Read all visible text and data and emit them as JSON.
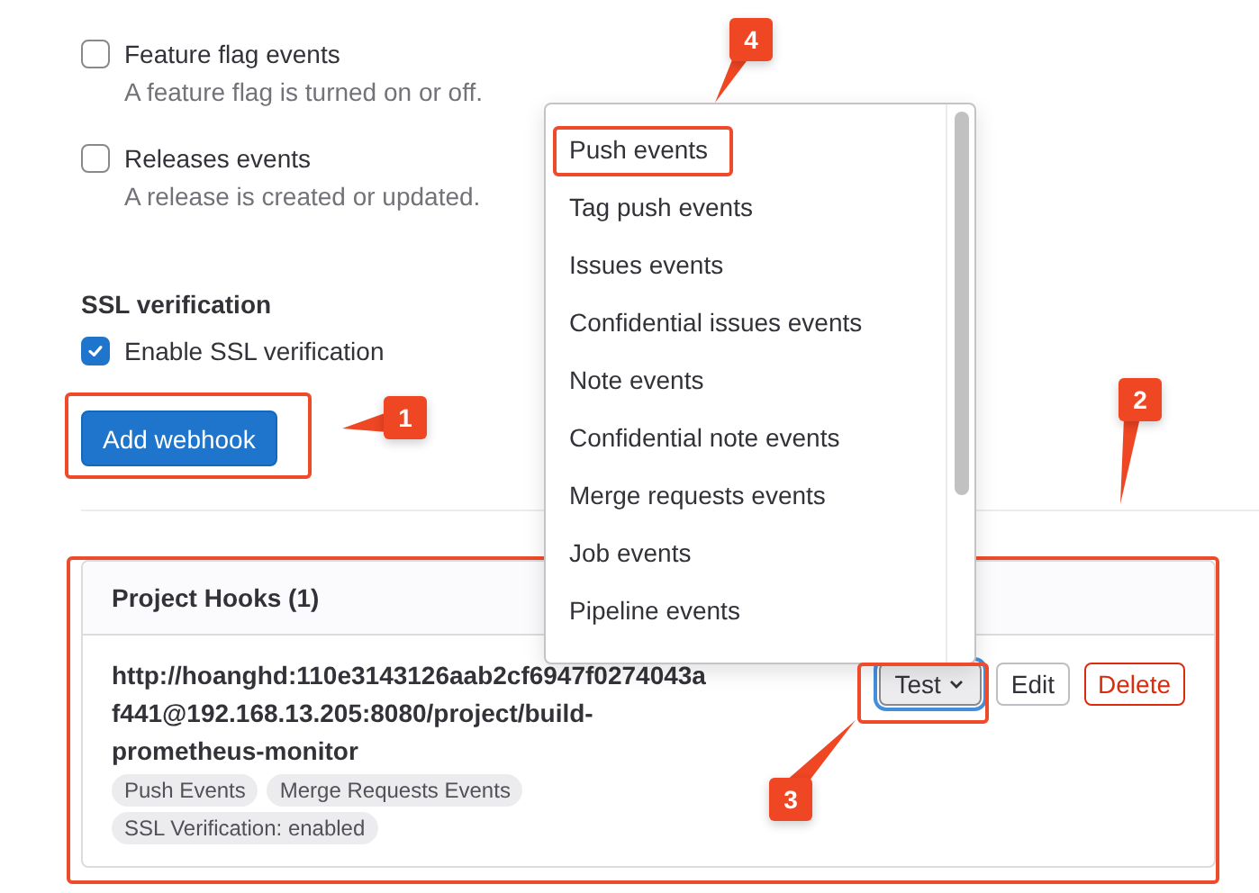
{
  "events": [
    {
      "label": "Feature flag events",
      "description": "A feature flag is turned on or off.",
      "checked": false
    },
    {
      "label": "Releases events",
      "description": "A release is created or updated.",
      "checked": false
    }
  ],
  "ssl": {
    "heading": "SSL verification",
    "label": "Enable SSL verification",
    "checked": true
  },
  "submit_button": "Add webhook",
  "hooks_panel": {
    "title": "Project Hooks (1)",
    "hooks": [
      {
        "url": "http://hoanghd:110e3143126aab2cf6947f0274043af441@192.168.13.205:8080/project/build-prometheus-monitor",
        "tags": [
          "Push Events",
          "Merge Requests Events",
          "SSL Verification: enabled"
        ],
        "actions": [
          {
            "label": "Test",
            "kind": "dropdown"
          },
          {
            "label": "Edit",
            "kind": "default"
          },
          {
            "label": "Delete",
            "kind": "danger"
          }
        ]
      }
    ]
  },
  "test_menu": {
    "items": [
      "Push events",
      "Tag push events",
      "Issues events",
      "Confidential issues events",
      "Note events",
      "Confidential note events",
      "Merge requests events",
      "Job events",
      "Pipeline events"
    ]
  },
  "annotations": [
    {
      "label": "1"
    },
    {
      "label": "2"
    },
    {
      "label": "3"
    },
    {
      "label": "4"
    }
  ]
}
